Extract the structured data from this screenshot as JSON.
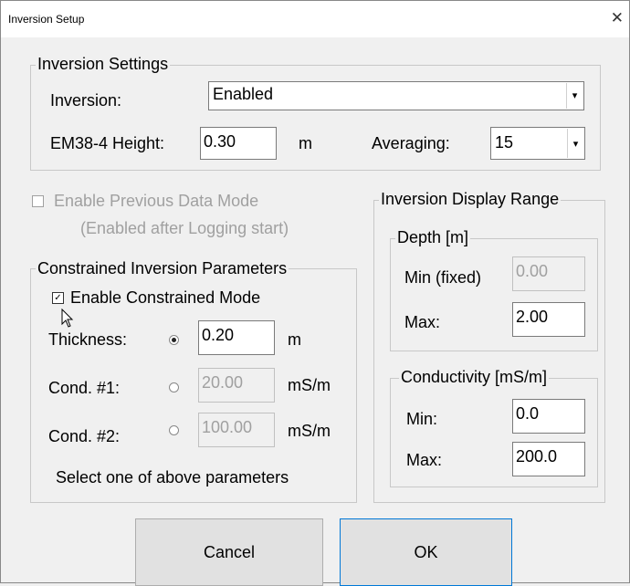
{
  "window": {
    "title": "Inversion Setup",
    "close_glyph": "✕"
  },
  "inversion_settings": {
    "legend": "Inversion Settings",
    "inversion_label": "Inversion:",
    "inversion_value": "Enabled",
    "height_label": "EM38-4 Height:",
    "height_value": "0.30",
    "height_unit": "m",
    "averaging_label": "Averaging:",
    "averaging_value": "15"
  },
  "previous_data": {
    "label": "Enable Previous Data Mode",
    "note": "(Enabled after Logging start)",
    "checked": false
  },
  "constrained": {
    "legend": "Constrained Inversion Parameters",
    "enable_label": "Enable Constrained Mode",
    "enable_checked": true,
    "thickness_label": "Thickness:",
    "thickness_value": "0.20",
    "thickness_unit": "m",
    "cond1_label": "Cond. #1:",
    "cond1_value": "20.00",
    "cond1_unit": "mS/m",
    "cond2_label": "Cond. #2:",
    "cond2_value": "100.00",
    "cond2_unit": "mS/m",
    "selected": "thickness",
    "hint": "Select one of above parameters"
  },
  "display_range": {
    "legend": "Inversion Display Range",
    "depth": {
      "legend": "Depth [m]",
      "min_label": "Min (fixed)",
      "min_value": "0.00",
      "max_label": "Max:",
      "max_value": "2.00"
    },
    "conductivity": {
      "legend": "Conductivity [mS/m]",
      "min_label": "Min:",
      "min_value": "0.0",
      "max_label": "Max:",
      "max_value": "200.0"
    }
  },
  "buttons": {
    "cancel": "Cancel",
    "ok": "OK"
  }
}
